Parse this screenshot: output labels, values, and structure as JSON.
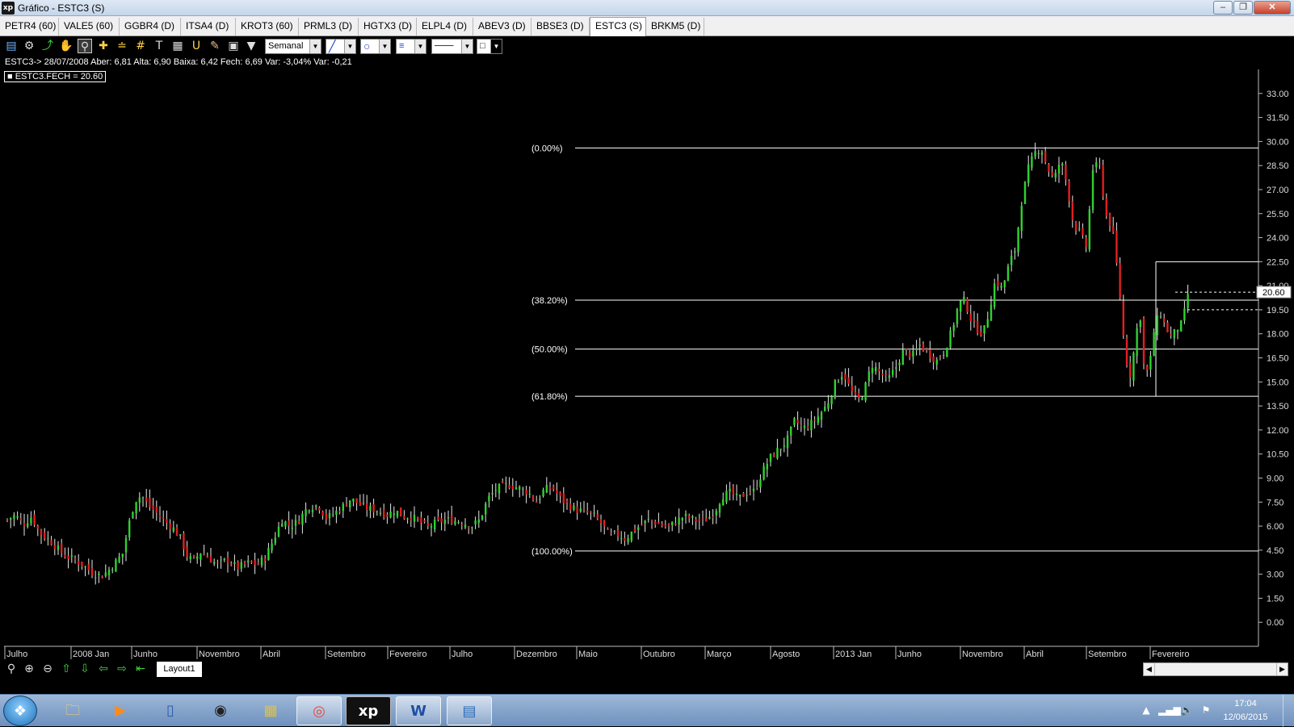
{
  "window": {
    "title": "Gráfico - ESTC3 (S)",
    "app_icon": "xp",
    "controls": [
      "minimize-icon",
      "maximize-icon",
      "close-icon"
    ]
  },
  "tabs": [
    {
      "label": "PETR4 (60)",
      "active": false
    },
    {
      "label": "VALE5 (60)",
      "active": false
    },
    {
      "label": "GGBR4 (D)",
      "active": false
    },
    {
      "label": "ITSA4 (D)",
      "active": false
    },
    {
      "label": "KROT3 (60)",
      "active": false
    },
    {
      "label": "PRML3 (D)",
      "active": false
    },
    {
      "label": "HGTX3 (D)",
      "active": false
    },
    {
      "label": "ELPL4 (D)",
      "active": false
    },
    {
      "label": "ABEV3 (D)",
      "active": false
    },
    {
      "label": "BBSE3 (D)",
      "active": false
    },
    {
      "label": "ESTC3 (S)",
      "active": true
    },
    {
      "label": "BRKM5 (D)",
      "active": false
    }
  ],
  "toolbar": {
    "period_select": "Semanal",
    "icons": [
      "chart-icon",
      "gear-icon",
      "draw-icon",
      "hand-icon",
      "zoom-area-icon",
      "crosshair-icon",
      "parallel-lines-icon",
      "grid-icon",
      "text-icon",
      "calculator-icon",
      "magnet-icon",
      "brush-icon",
      "clipboard-icon",
      "filter-icon"
    ]
  },
  "info_line": "ESTC3-> 28/07/2008 Aber: 6,81 Alta: 6,90 Baixa: 6,42 Fech: 6,69 Var: -3,04% Var: -0,21",
  "legend_label": "ESTC3.FECH = 20.60",
  "fibonacci": [
    {
      "label": "(0.00%)",
      "price": 29.6
    },
    {
      "label": "(38.20%)",
      "price": 20.1
    },
    {
      "label": "(50.00%)",
      "price": 17.05
    },
    {
      "label": "(61.80%)",
      "price": 14.1
    },
    {
      "label": "(100.00%)",
      "price": 4.45
    }
  ],
  "price_axis": {
    "ticks": [
      "33.00",
      "31.50",
      "30.00",
      "28.50",
      "27.00",
      "25.50",
      "24.00",
      "22.50",
      "21.00",
      "19.50",
      "18.00",
      "16.50",
      "15.00",
      "13.50",
      "12.00",
      "10.50",
      "9.00",
      "7.50",
      "6.00",
      "4.50",
      "3.00",
      "1.50",
      "0.00"
    ],
    "current_price": "20.60"
  },
  "time_axis": {
    "labels": [
      "Julho",
      "2008 Jan",
      "Junho",
      "Novembro",
      "Abril",
      "Setembro",
      "Fevereiro",
      "Julho",
      "Dezembro",
      "Maio",
      "Outubro",
      "Março",
      "Agosto",
      "2013 Jan",
      "Junho",
      "Novembro",
      "Abril",
      "Setembro",
      "Fevereiro"
    ]
  },
  "chart_data": {
    "type": "candlestick",
    "symbol": "ESTC3",
    "period": "Semanal",
    "ylim": [
      -1.5,
      34.5
    ],
    "colors": {
      "up": "#2fd12f",
      "down": "#e02020",
      "wick": "#e8e8e8",
      "fib_line": "#ffffff"
    },
    "close_path": [
      [
        0,
        6.4
      ],
      [
        10,
        6.7
      ],
      [
        20,
        6.1
      ],
      [
        30,
        6.6
      ],
      [
        40,
        5.6
      ],
      [
        55,
        5.0
      ],
      [
        70,
        4.2
      ],
      [
        90,
        3.7
      ],
      [
        105,
        3.1
      ],
      [
        118,
        2.9
      ],
      [
        130,
        3.5
      ],
      [
        143,
        4.3
      ],
      [
        150,
        6.0
      ],
      [
        158,
        7.6
      ],
      [
        166,
        7.9
      ],
      [
        175,
        7.3
      ],
      [
        185,
        6.8
      ],
      [
        195,
        6.3
      ],
      [
        205,
        5.9
      ],
      [
        215,
        5.2
      ],
      [
        222,
        4.2
      ],
      [
        230,
        3.8
      ],
      [
        240,
        4.4
      ],
      [
        250,
        4.0
      ],
      [
        260,
        3.6
      ],
      [
        272,
        3.9
      ],
      [
        285,
        3.4
      ],
      [
        298,
        3.7
      ],
      [
        310,
        3.6
      ],
      [
        320,
        4.1
      ],
      [
        330,
        5.2
      ],
      [
        340,
        6.4
      ],
      [
        350,
        6.0
      ],
      [
        360,
        6.3
      ],
      [
        372,
        7.2
      ],
      [
        385,
        7.3
      ],
      [
        395,
        6.5
      ],
      [
        405,
        6.8
      ],
      [
        415,
        7.2
      ],
      [
        425,
        7.7
      ],
      [
        435,
        7.4
      ],
      [
        445,
        7.1
      ],
      [
        458,
        7.0
      ],
      [
        470,
        6.7
      ],
      [
        480,
        7.0
      ],
      [
        490,
        6.6
      ],
      [
        500,
        6.6
      ],
      [
        510,
        6.3
      ],
      [
        520,
        5.9
      ],
      [
        530,
        6.2
      ],
      [
        545,
        6.4
      ],
      [
        560,
        6.3
      ],
      [
        575,
        6.0
      ],
      [
        585,
        6.4
      ],
      [
        595,
        7.7
      ],
      [
        605,
        8.3
      ],
      [
        620,
        8.6
      ],
      [
        632,
        8.4
      ],
      [
        645,
        8.1
      ],
      [
        655,
        7.5
      ],
      [
        665,
        8.3
      ],
      [
        675,
        8.4
      ],
      [
        685,
        7.7
      ],
      [
        695,
        7.3
      ],
      [
        705,
        7.0
      ],
      [
        715,
        6.9
      ],
      [
        725,
        6.7
      ],
      [
        735,
        6.2
      ],
      [
        745,
        5.4
      ],
      [
        755,
        5.5
      ],
      [
        765,
        5.2
      ],
      [
        775,
        5.7
      ],
      [
        785,
        6.1
      ],
      [
        795,
        6.4
      ],
      [
        808,
        6.1
      ],
      [
        818,
        5.9
      ],
      [
        828,
        6.3
      ],
      [
        838,
        6.6
      ],
      [
        850,
        6.4
      ],
      [
        862,
        6.3
      ],
      [
        875,
        6.8
      ],
      [
        885,
        7.9
      ],
      [
        895,
        8.1
      ],
      [
        905,
        7.7
      ],
      [
        915,
        8.1
      ],
      [
        925,
        8.2
      ],
      [
        935,
        9.4
      ],
      [
        945,
        10.3
      ],
      [
        955,
        10.8
      ],
      [
        965,
        11.3
      ],
      [
        975,
        12.6
      ],
      [
        985,
        12.1
      ],
      [
        995,
        12.4
      ],
      [
        1005,
        12.9
      ],
      [
        1015,
        13.6
      ],
      [
        1025,
        14.9
      ],
      [
        1035,
        15.6
      ],
      [
        1043,
        14.6
      ],
      [
        1052,
        13.8
      ],
      [
        1060,
        14.3
      ],
      [
        1070,
        16.1
      ],
      [
        1080,
        15.6
      ],
      [
        1090,
        15.1
      ],
      [
        1100,
        15.9
      ],
      [
        1110,
        17.0
      ],
      [
        1120,
        16.6
      ],
      [
        1130,
        17.3
      ],
      [
        1140,
        16.8
      ],
      [
        1150,
        16.3
      ],
      [
        1160,
        16.9
      ],
      [
        1170,
        18.3
      ],
      [
        1178,
        19.9
      ],
      [
        1185,
        20.1
      ],
      [
        1193,
        18.9
      ],
      [
        1200,
        18.3
      ],
      [
        1208,
        18.0
      ],
      [
        1215,
        19.3
      ],
      [
        1223,
        21.3
      ],
      [
        1232,
        20.8
      ],
      [
        1240,
        22.3
      ],
      [
        1248,
        23.3
      ],
      [
        1256,
        26.3
      ],
      [
        1264,
        28.3
      ],
      [
        1272,
        29.3
      ],
      [
        1280,
        29.6
      ],
      [
        1288,
        28.3
      ],
      [
        1296,
        27.6
      ],
      [
        1304,
        28.9
      ],
      [
        1312,
        27.3
      ],
      [
        1320,
        24.8
      ],
      [
        1328,
        24.3
      ],
      [
        1336,
        23.4
      ],
      [
        1344,
        28.3
      ],
      [
        1352,
        28.6
      ],
      [
        1360,
        25.4
      ],
      [
        1368,
        24.6
      ],
      [
        1376,
        21.2
      ],
      [
        1384,
        16.6
      ],
      [
        1390,
        15.4
      ],
      [
        1396,
        17.3
      ],
      [
        1402,
        19.6
      ],
      [
        1408,
        15.4
      ],
      [
        1414,
        15.9
      ],
      [
        1420,
        18.3
      ],
      [
        1427,
        19.4
      ],
      [
        1434,
        18.4
      ],
      [
        1441,
        17.8
      ],
      [
        1448,
        18.3
      ],
      [
        1455,
        18.7
      ],
      [
        1462,
        20.6
      ]
    ]
  },
  "bottom_toolbar": {
    "icons": [
      "zoom-icon",
      "zoom-in-icon",
      "zoom-out-icon",
      "arrow-up-icon",
      "arrow-down-icon",
      "arrow-left-icon",
      "arrow-right-icon",
      "arrow-back-icon"
    ],
    "layout_tab": "Layout1"
  },
  "taskbar": {
    "apps": [
      "folder-icon",
      "media-player-icon",
      "network-icon",
      "hp-icon",
      "scanner-icon",
      "chrome-icon",
      "xp-icon",
      "word-icon",
      "photos-icon"
    ],
    "time": "17:04",
    "date": "12/06/2015"
  }
}
